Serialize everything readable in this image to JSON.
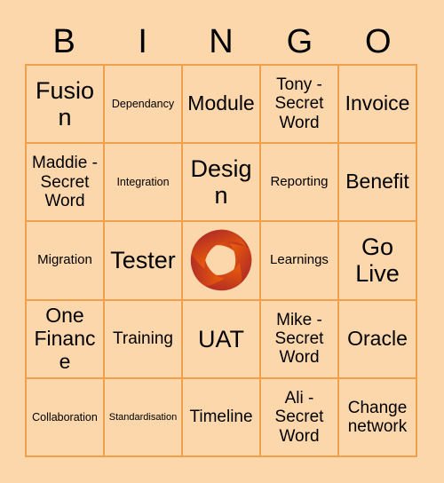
{
  "header": {
    "letters": [
      "B",
      "I",
      "N",
      "G",
      "O"
    ]
  },
  "colors": {
    "background": "#fcd7ab",
    "cell_background": "#fcd7ab",
    "grid_line": "#f0a04b",
    "text": "#000000",
    "logo_orange": "#e8690b",
    "logo_crimson": "#9e1b2f"
  },
  "grid": {
    "rows": [
      [
        {
          "label": "Fusion",
          "size": "sz-xl"
        },
        {
          "label": "Dependancy",
          "size": "sz-xs"
        },
        {
          "label": "Module",
          "size": "sz-lg"
        },
        {
          "label": "Tony - Secret Word",
          "size": "sz-md"
        },
        {
          "label": "Invoice",
          "size": "sz-lg"
        }
      ],
      [
        {
          "label": "Maddie - Secret Word",
          "size": "sz-md"
        },
        {
          "label": "Integration",
          "size": "sz-xs"
        },
        {
          "label": "Design",
          "size": "sz-xl"
        },
        {
          "label": "Reporting",
          "size": "sz-sm"
        },
        {
          "label": "Benefit",
          "size": "sz-lg"
        }
      ],
      [
        {
          "label": "Migration",
          "size": "sz-sm"
        },
        {
          "label": "Tester",
          "size": "sz-xl"
        },
        {
          "label": "",
          "size": "sz-md",
          "icon": "company-logo-icon"
        },
        {
          "label": "Learnings",
          "size": "sz-sm"
        },
        {
          "label": "Go Live",
          "size": "sz-xl"
        }
      ],
      [
        {
          "label": "One Finance",
          "size": "sz-lg"
        },
        {
          "label": "Training",
          "size": "sz-md"
        },
        {
          "label": "UAT",
          "size": "sz-xl"
        },
        {
          "label": "Mike - Secret Word",
          "size": "sz-md"
        },
        {
          "label": "Oracle",
          "size": "sz-lg"
        }
      ],
      [
        {
          "label": "Collaboration",
          "size": "sz-xs"
        },
        {
          "label": "Standardisation",
          "size": "sz-xxs"
        },
        {
          "label": "Timeline",
          "size": "sz-md"
        },
        {
          "label": "Ali - Secret Word",
          "size": "sz-md"
        },
        {
          "label": "Change network",
          "size": "sz-md"
        }
      ]
    ]
  }
}
